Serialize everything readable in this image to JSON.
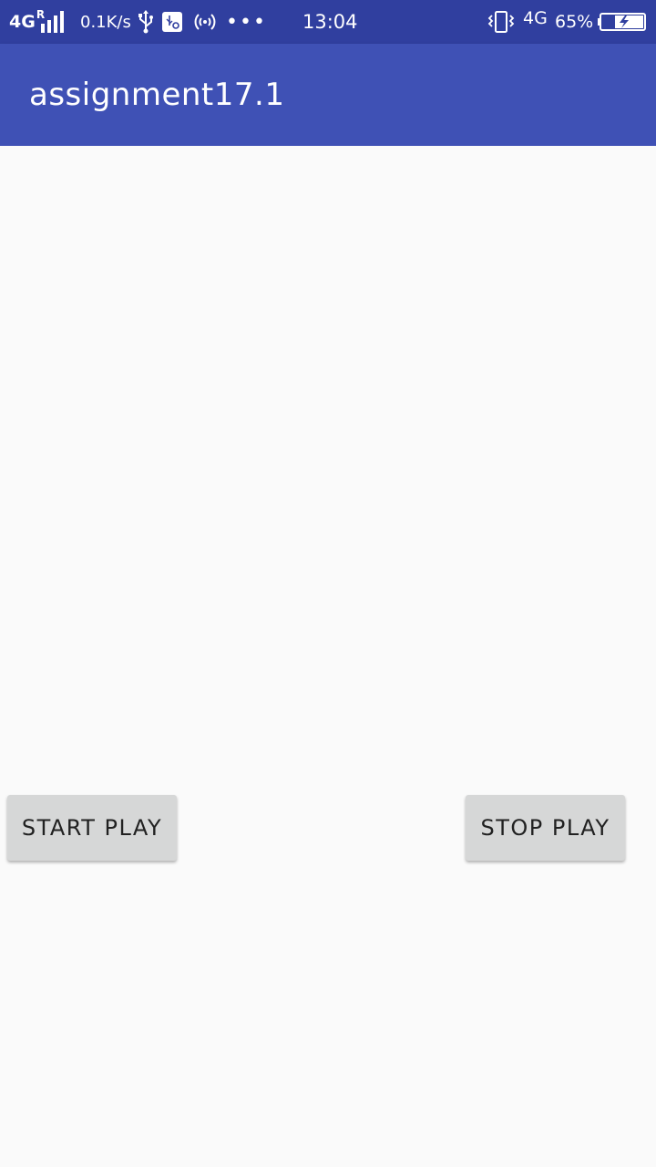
{
  "status_bar": {
    "network_left": "4G",
    "roaming": "R",
    "speed": "0.1K/s",
    "time": "13:04",
    "network_right": "4G",
    "battery_percent": "65%",
    "icons": [
      "signal-icon",
      "usb-icon",
      "usb-debug-icon",
      "hotspot-icon",
      "more-icon",
      "vibrate-icon",
      "battery-charging-icon"
    ]
  },
  "app_bar": {
    "title": "assignment17.1"
  },
  "buttons": {
    "start_label": "START PLAY",
    "stop_label": "STOP PLAY"
  },
  "colors": {
    "status_bar": "#303f9f",
    "app_bar": "#3f51b5",
    "background": "#fafafa",
    "button": "#d6d7d7",
    "button_text": "#212121"
  }
}
